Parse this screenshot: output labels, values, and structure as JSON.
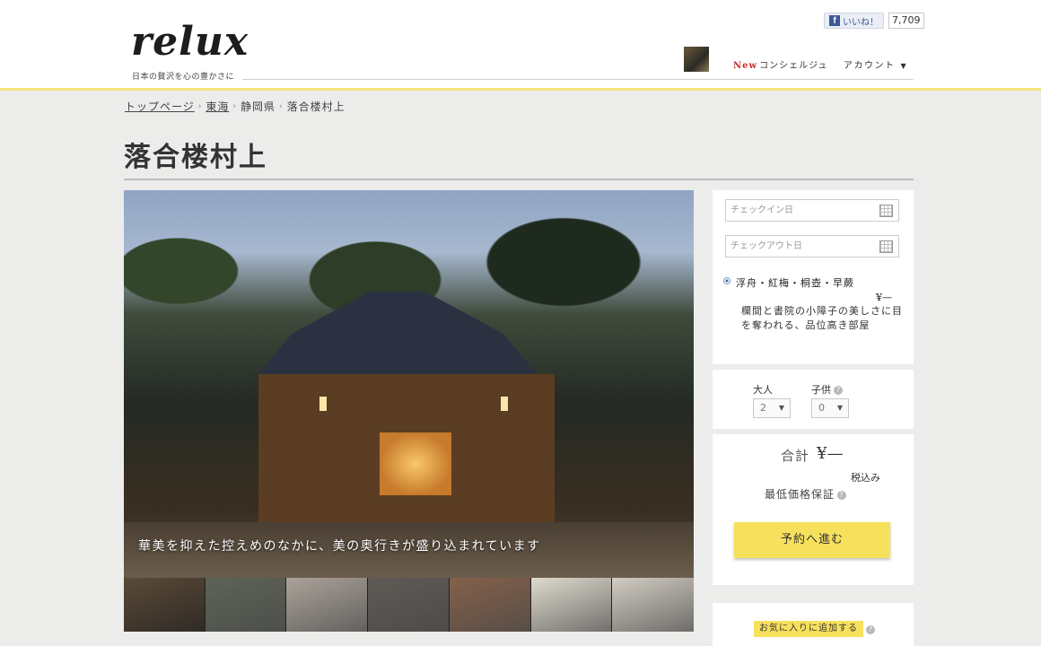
{
  "header": {
    "logo": "relux",
    "tagline": "日本の贅沢を心の豊かさに",
    "fb_like_label": "いいね！",
    "fb_like_count": "7,709",
    "nav_concierge_new": "New",
    "nav_concierge": "コンシェルジュ",
    "nav_account": "アカウント",
    "nav_account_caret": "▼"
  },
  "breadcrumb": {
    "items": [
      "トップページ",
      "東海",
      "静岡県",
      "落合楼村上"
    ],
    "separator": "›"
  },
  "page": {
    "title": "落合楼村上"
  },
  "hero": {
    "caption": "華美を抑えた控えめのなかに、美の奥行きが盛り込まれています"
  },
  "thumbnails": [
    {
      "color": "#5b4a38"
    },
    {
      "color": "#3a4232"
    },
    {
      "color": "#9a8f84"
    },
    {
      "color": "#3d3630"
    },
    {
      "color": "#6a3e22"
    },
    {
      "color": "#d8d2c3"
    },
    {
      "color": "#c9c2b5"
    }
  ],
  "booking": {
    "checkin_placeholder": "チェックイン日",
    "checkout_placeholder": "チェックアウト日",
    "room_name": "浮舟・紅梅・桐壺・早蕨",
    "room_price": "¥—",
    "room_description": "欄間と書院の小障子の美しさに目を奪われる、品位高き部屋",
    "adults_label": "大人",
    "children_label": "子供",
    "help_glyph": "?",
    "adults_value": "2",
    "children_value": "0",
    "select_caret": "▼",
    "total_label": "合計",
    "total_value": "¥—",
    "tax_label": "税込み",
    "guarantee_label": "最低価格保証",
    "reserve_button": "予約へ進む",
    "favorite_button": "お気に入りに追加する"
  },
  "colors": {
    "accent_yellow": "#f7e05c",
    "header_border": "#f6e27a",
    "new_red": "#c9302c",
    "facebook_blue": "#3b5998"
  }
}
